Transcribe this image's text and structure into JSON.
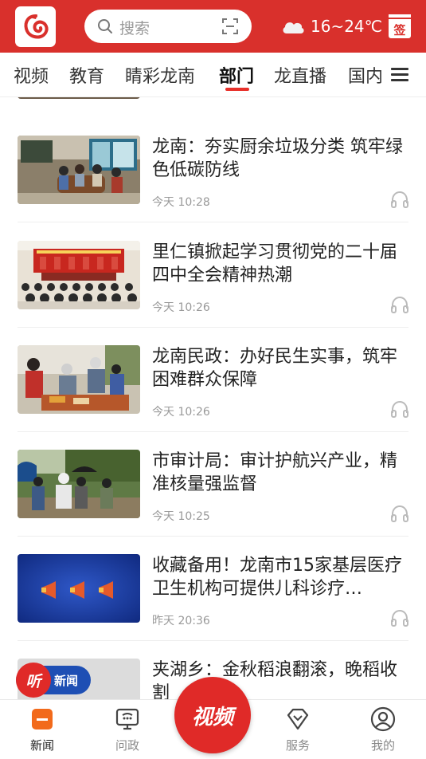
{
  "header": {
    "search_placeholder": "搜索",
    "weather_temp": "16~24℃",
    "sign_label": "签",
    "brand_color": "#d9302c"
  },
  "tabs": [
    "视频",
    "教育",
    "睛彩龙南",
    "部门",
    "龙直播",
    "国内"
  ],
  "active_tab": "部门",
  "feed": [
    {
      "title": "龙南：夯实厨余垃圾分类 筑牢绿色低碳防线",
      "time": "今天 10:28"
    },
    {
      "title": "里仁镇掀起学习贯彻党的二十届四中全会精神热潮",
      "time": "今天 10:26"
    },
    {
      "title": "龙南民政：办好民生实事，筑牢困难群众保障",
      "time": "今天 10:26"
    },
    {
      "title": "市审计局：审计护航兴产业，精准核量强监督",
      "time": "今天 10:25"
    },
    {
      "title": "收藏备用！龙南市15家基层医疗卫生机构可提供儿科诊疗…",
      "time": "昨天 20:36"
    },
    {
      "title": "夹湖乡：金秋稻浪翻滚，晚稻收割",
      "time": ""
    }
  ],
  "listen_badge": {
    "icon": "听",
    "label": "新闻"
  },
  "bottom_nav": {
    "news": "新闻",
    "wenzheng": "问政",
    "video": "视频",
    "service": "服务",
    "mine": "我的"
  }
}
